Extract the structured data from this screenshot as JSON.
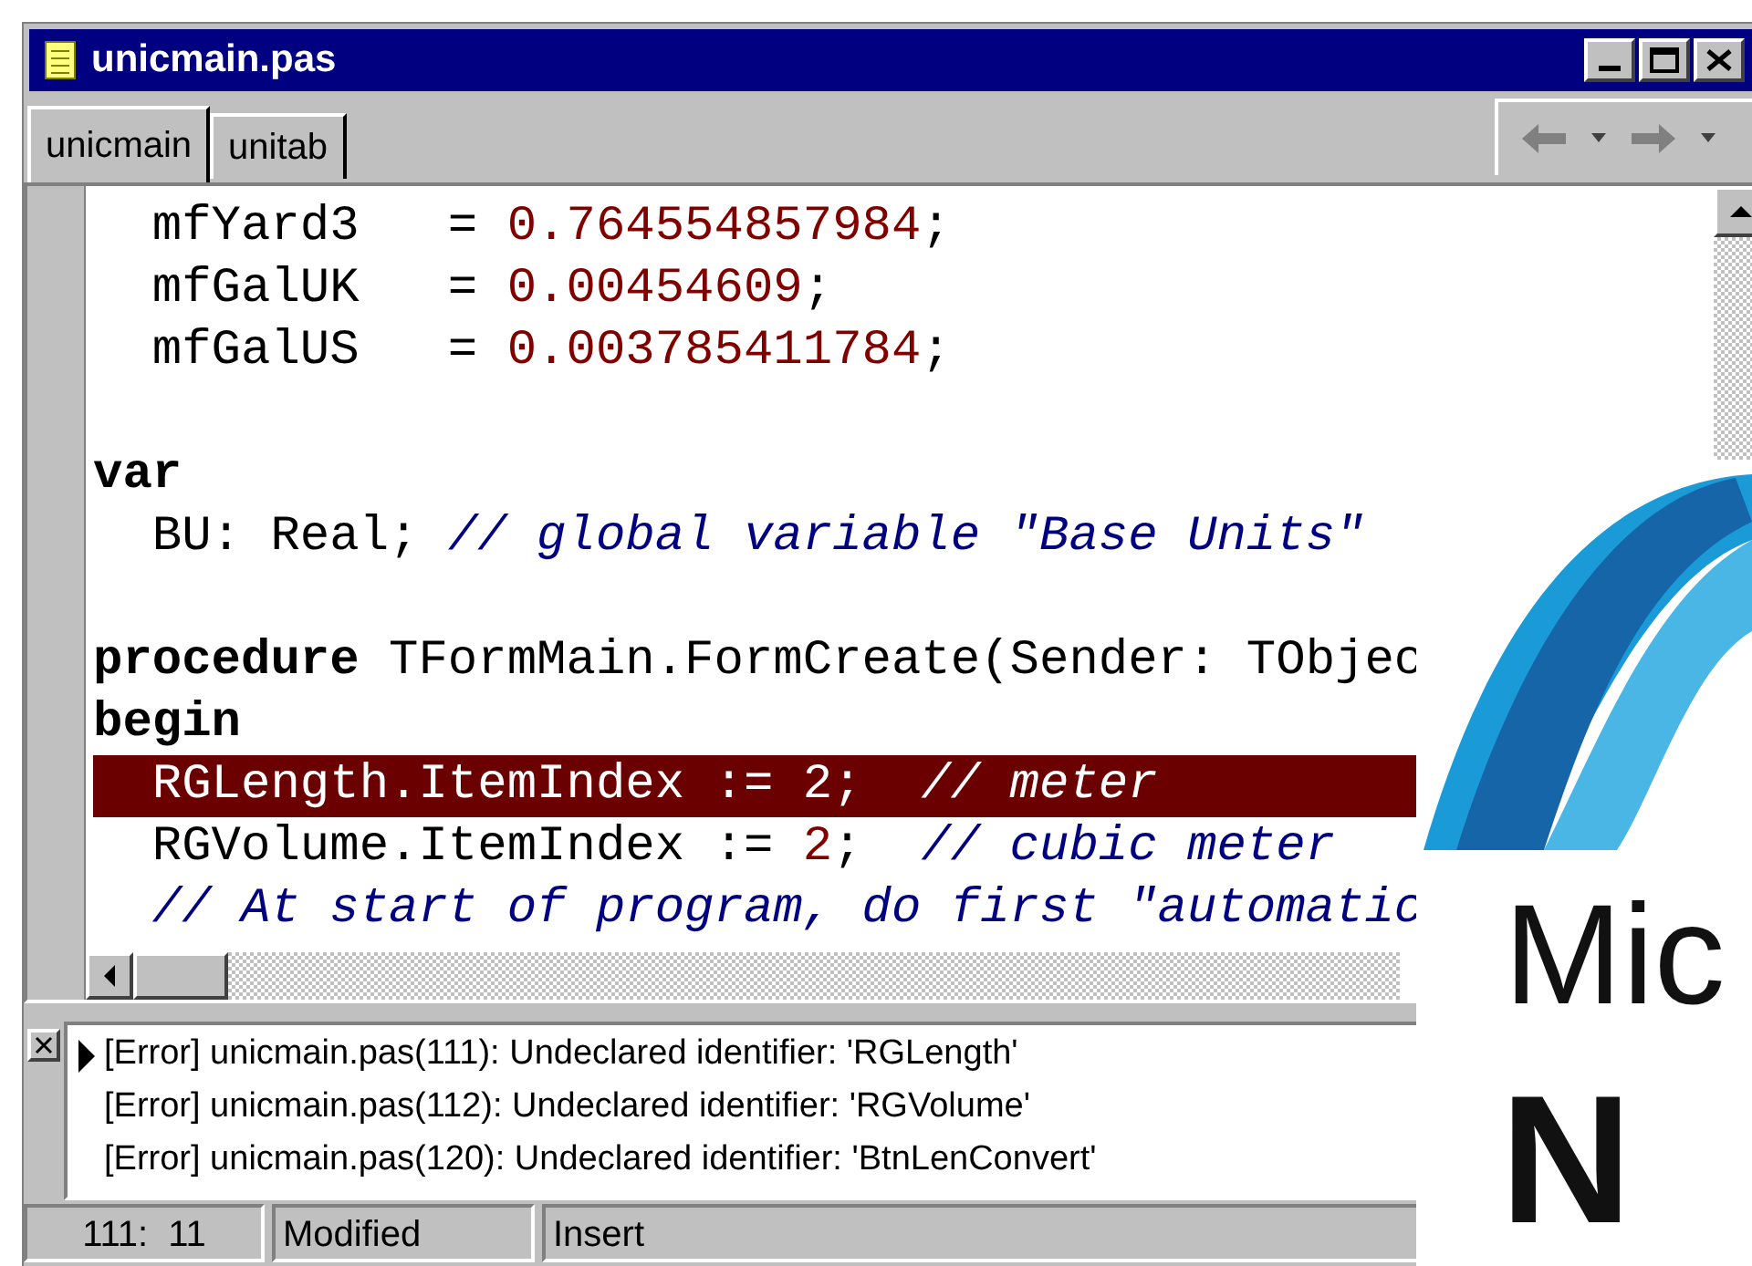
{
  "window": {
    "title": "unicmain.pas"
  },
  "tabs": [
    {
      "label": "unicmain",
      "selected": true
    },
    {
      "label": "unitab",
      "selected": false
    }
  ],
  "editor": {
    "lines": [
      {
        "selected": false,
        "segments": [
          {
            "kind": "plain",
            "text": "  mfYard3   = "
          },
          {
            "kind": "number",
            "text": "0.764554857984"
          },
          {
            "kind": "plain",
            "text": ";"
          }
        ]
      },
      {
        "selected": false,
        "segments": [
          {
            "kind": "plain",
            "text": "  mfGalUK   = "
          },
          {
            "kind": "number",
            "text": "0.00454609"
          },
          {
            "kind": "plain",
            "text": ";"
          }
        ]
      },
      {
        "selected": false,
        "segments": [
          {
            "kind": "plain",
            "text": "  mfGalUS   = "
          },
          {
            "kind": "number",
            "text": "0.003785411784"
          },
          {
            "kind": "plain",
            "text": ";"
          }
        ]
      },
      {
        "selected": false
      },
      {
        "selected": false,
        "segments": [
          {
            "kind": "keyword",
            "text": "var"
          }
        ]
      },
      {
        "selected": false,
        "segments": [
          {
            "kind": "plain",
            "text": "  BU: Real; "
          },
          {
            "kind": "comment",
            "text": "// global variable \"Base Units\""
          }
        ]
      },
      {
        "selected": false
      },
      {
        "selected": false,
        "segments": [
          {
            "kind": "keyword",
            "text": "procedure"
          },
          {
            "kind": "plain",
            "text": " TFormMain.FormCreate(Sender: TObjec"
          }
        ]
      },
      {
        "selected": false,
        "segments": [
          {
            "kind": "keyword",
            "text": "begin"
          }
        ]
      },
      {
        "selected": true,
        "segments": [
          {
            "kind": "plain",
            "text": "  RGLength.ItemIndex := "
          },
          {
            "kind": "number",
            "text": "2"
          },
          {
            "kind": "plain",
            "text": ";  "
          },
          {
            "kind": "comment",
            "text": "// meter"
          }
        ]
      },
      {
        "selected": false,
        "segments": [
          {
            "kind": "plain",
            "text": "  RGVolume.ItemIndex := "
          },
          {
            "kind": "number",
            "text": "2"
          },
          {
            "kind": "plain",
            "text": ";  "
          },
          {
            "kind": "comment",
            "text": "// cubic meter"
          }
        ]
      },
      {
        "selected": false,
        "segments": [
          {
            "kind": "comment",
            "text": "  // At start of program, do first \"automatic"
          }
        ]
      }
    ]
  },
  "messages": [
    {
      "text": "[Error] unicmain.pas(111): Undeclared identifier: 'RGLength'",
      "selected": true
    },
    {
      "text": "[Error] unicmain.pas(112): Undeclared identifier: 'RGVolume'",
      "selected": false
    },
    {
      "text": "[Error] unicmain.pas(120): Undeclared identifier: 'BtnLenConvert'",
      "selected": false
    }
  ],
  "status_bar": {
    "position": "111:  11",
    "state": "Modified",
    "mode": "Insert"
  },
  "overlay_logo": {
    "line_1": "Mic",
    "line_2": "N"
  }
}
